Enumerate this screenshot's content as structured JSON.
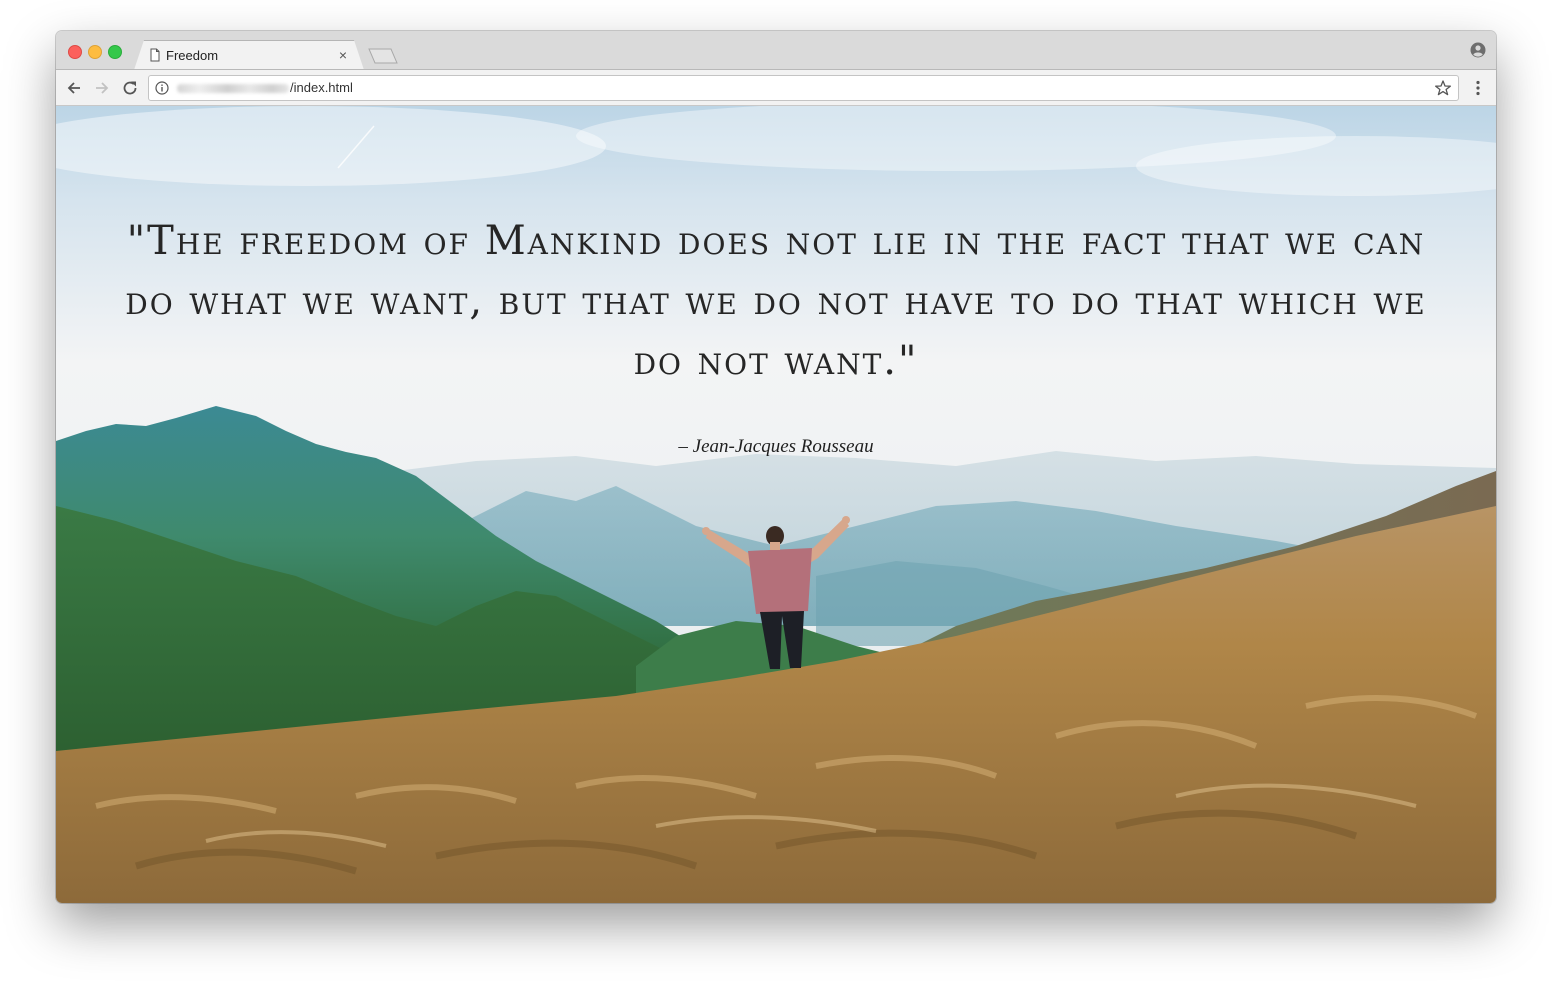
{
  "browser": {
    "tab_title": "Freedom",
    "tab_close": "×",
    "url_path": "/index.html",
    "icons": {
      "page": "page-icon",
      "close": "close-icon",
      "back": "back-arrow-icon",
      "forward": "forward-arrow-icon",
      "reload": "reload-icon",
      "info": "info-icon",
      "bookmark": "star-icon",
      "menu": "kebab-menu-icon",
      "profile": "profile-icon"
    }
  },
  "page": {
    "quote": "\"The freedom of Mankind does not lie in the fact that we can do what we want, but that we do not have to do that which we do not want.\"",
    "author": "– Jean-Jacques Rousseau"
  },
  "colors": {
    "sky": "#e9eef1",
    "grass": "#b08a4e",
    "mountains": "#2f7a6a",
    "text": "#262626"
  }
}
